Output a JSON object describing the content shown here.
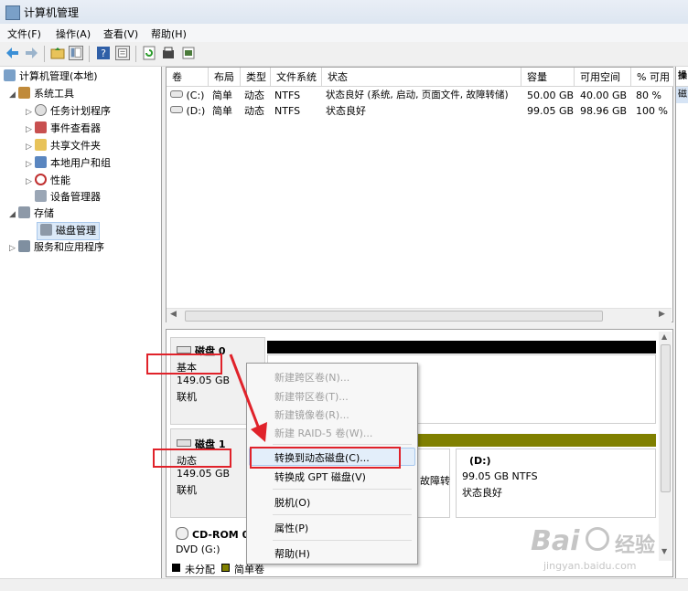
{
  "window": {
    "title": "计算机管理"
  },
  "menu": [
    "文件(F)",
    "操作(A)",
    "查看(V)",
    "帮助(H)"
  ],
  "toolbar": {
    "icons": [
      "back-arrow-icon",
      "forward-arrow-icon",
      "up-folder-icon",
      "show-tree-icon",
      "help-icon",
      "details-icon",
      "refresh-icon",
      "properties-icon",
      "export-icon"
    ]
  },
  "tree": {
    "root": "计算机管理(本地)",
    "system_tools": "系统工具",
    "task_scheduler": "任务计划程序",
    "event_viewer": "事件查看器",
    "shared_folders": "共享文件夹",
    "local_users": "本地用户和组",
    "performance": "性能",
    "device_manager": "设备管理器",
    "storage": "存储",
    "disk_management": "磁盘管理",
    "services_apps": "服务和应用程序"
  },
  "columns": [
    "卷",
    "布局",
    "类型",
    "文件系统",
    "状态",
    "容量",
    "可用空间",
    "% 可用"
  ],
  "volumes": [
    {
      "vol": "(C:)",
      "layout": "简单",
      "type": "动态",
      "fs": "NTFS",
      "status": "状态良好 (系统, 启动, 页面文件, 故障转储)",
      "capacity": "50.00 GB",
      "free": "40.00 GB",
      "pct": "80 %"
    },
    {
      "vol": "(D:)",
      "layout": "简单",
      "type": "动态",
      "fs": "NTFS",
      "status": "状态良好",
      "capacity": "99.05 GB",
      "free": "98.96 GB",
      "pct": "100 %"
    }
  ],
  "right_strip": {
    "header": "操",
    "item": "磁"
  },
  "disks": {
    "disk0": {
      "name": "磁盘 0",
      "type": "基本",
      "size": "149.05 GB",
      "state": "联机"
    },
    "disk1": {
      "name": "磁盘 1",
      "type": "动态",
      "size": "149.05 GB",
      "state": "联机",
      "partial_status": "故障转",
      "vol_d": {
        "label": "(D:)",
        "size": "99.05 GB NTFS",
        "status": "状态良好"
      }
    },
    "cdrom": {
      "name": "CD-ROM 0",
      "type": "DVD (G:)"
    }
  },
  "legend": {
    "unallocated": "未分配",
    "simple": "简单卷"
  },
  "context_menu": {
    "new_spanned": "新建跨区卷(N)...",
    "new_striped": "新建带区卷(T)...",
    "new_mirrored": "新建镜像卷(R)...",
    "new_raid5": "新建 RAID-5 卷(W)...",
    "convert_dynamic": "转换到动态磁盘(C)...",
    "convert_gpt": "转换成 GPT 磁盘(V)",
    "offline": "脱机(O)",
    "properties": "属性(P)",
    "help": "帮助(H)"
  },
  "watermark": {
    "brand": "Bai",
    "brand2": "经验",
    "url": "jingyan.baidu.com"
  },
  "colors": {
    "annotation_red": "#e0222a",
    "unallocated": "#000000",
    "simple_volume": "#808000",
    "selection": "#dbe9f8"
  }
}
